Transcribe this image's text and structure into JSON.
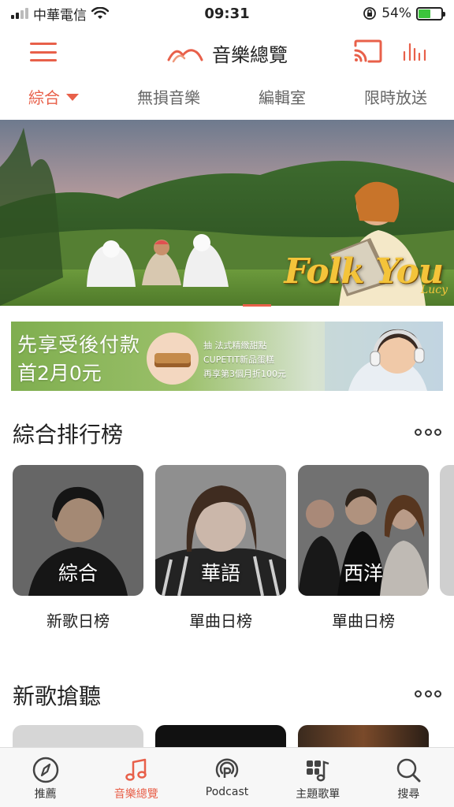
{
  "status_bar": {
    "carrier": "中華電信",
    "time": "09:31",
    "battery": "54%",
    "battery_level": 0.54
  },
  "header": {
    "title": "音樂總覽"
  },
  "tabs": [
    {
      "label": "綜合",
      "active": true
    },
    {
      "label": "無損音樂",
      "active": false
    },
    {
      "label": "編輯室",
      "active": false
    },
    {
      "label": "限時放送",
      "active": false
    }
  ],
  "hero": {
    "title": "Folk You",
    "signature": "Lucy"
  },
  "ad": {
    "line1": "先享受後付款",
    "line2": "首2月0元",
    "line3": "抽 法式精緻甜點",
    "line4": "CUPETIT新品蛋糕",
    "line5": "再享第3個月折100元"
  },
  "ranking": {
    "title": "綜合排行榜",
    "cards": [
      {
        "label": "綜合",
        "caption": "新歌日榜"
      },
      {
        "label": "華語",
        "caption": "單曲日榜"
      },
      {
        "label": "西洋",
        "caption": "單曲日榜"
      }
    ]
  },
  "new_songs": {
    "title": "新歌搶聽"
  },
  "bottom_nav": [
    {
      "label": "推薦",
      "icon": "compass-icon",
      "active": false
    },
    {
      "label": "音樂總覽",
      "icon": "music-note-icon",
      "active": true
    },
    {
      "label": "Podcast",
      "icon": "podcast-icon",
      "active": false
    },
    {
      "label": "主題歌單",
      "icon": "playlist-icon",
      "active": false
    },
    {
      "label": "搜尋",
      "icon": "search-icon",
      "active": false
    }
  ],
  "colors": {
    "accent": "#e8604a",
    "hero_title": "#f4c43a"
  }
}
